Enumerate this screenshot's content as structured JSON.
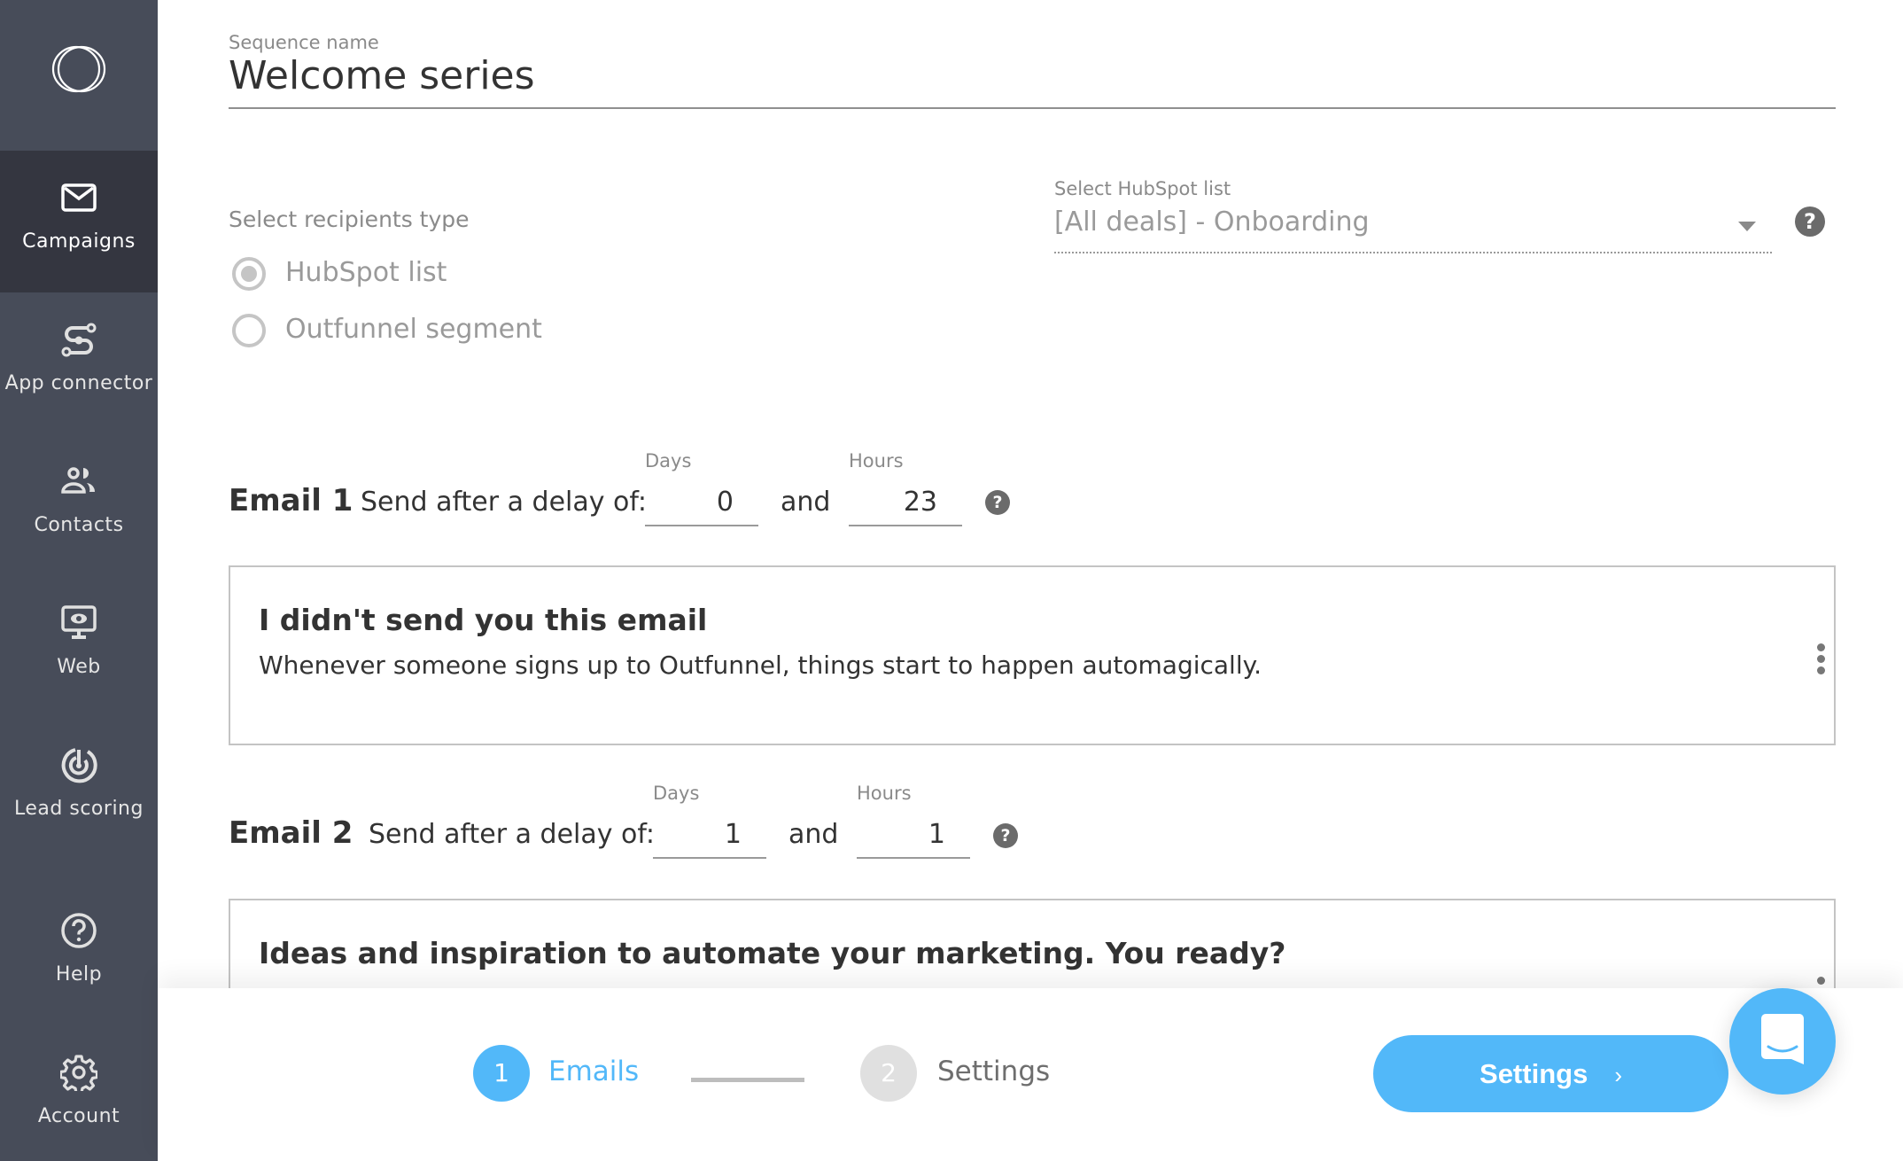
{
  "sidebar": {
    "items": [
      {
        "label": "Campaigns",
        "icon": "envelope-icon",
        "active": true
      },
      {
        "label": "App connector",
        "icon": "connector-icon",
        "active": false
      },
      {
        "label": "Contacts",
        "icon": "contacts-icon",
        "active": false
      },
      {
        "label": "Web",
        "icon": "monitor-eye-icon",
        "active": false
      },
      {
        "label": "Lead scoring",
        "icon": "target-icon",
        "active": false
      },
      {
        "label": "Help",
        "icon": "help-circle-icon",
        "active": false
      },
      {
        "label": "Account",
        "icon": "gear-icon",
        "active": false
      }
    ]
  },
  "sequence": {
    "label": "Sequence name",
    "name": "Welcome series"
  },
  "recipients": {
    "label": "Select recipients type",
    "options": [
      {
        "label": "HubSpot list",
        "checked": true
      },
      {
        "label": "Outfunnel segment",
        "checked": false
      }
    ]
  },
  "hubspot_list": {
    "label": "Select HubSpot list",
    "value": "[All deals] - Onboarding",
    "help": "?"
  },
  "emails": [
    {
      "title": "Email 1",
      "delay_text": "Send after a delay of:",
      "days_label": "Days",
      "days": "0",
      "and_text": "and",
      "hours_label": "Hours",
      "hours": "23",
      "help": "?",
      "subject": "I didn't send you this email",
      "preview": "Whenever someone signs up to Outfunnel, things start to happen automagically."
    },
    {
      "title": "Email 2",
      "delay_text": "Send after a delay of:",
      "days_label": "Days",
      "days": "1",
      "and_text": "and",
      "hours_label": "Hours",
      "hours": "1",
      "help": "?",
      "subject": "Ideas and inspiration to automate your marketing. You ready?"
    }
  ],
  "stepper": {
    "steps": [
      {
        "number": "1",
        "label": "Emails",
        "active": true
      },
      {
        "number": "2",
        "label": "Settings",
        "active": false
      }
    ]
  },
  "footer": {
    "next_button_label": "Settings",
    "next_button_chevron": "›"
  },
  "colors": {
    "accent": "#52b8f9",
    "sidebar_bg": "#474c59",
    "sidebar_active_bg": "#343640",
    "inactive_step": "#e0e0e0"
  }
}
